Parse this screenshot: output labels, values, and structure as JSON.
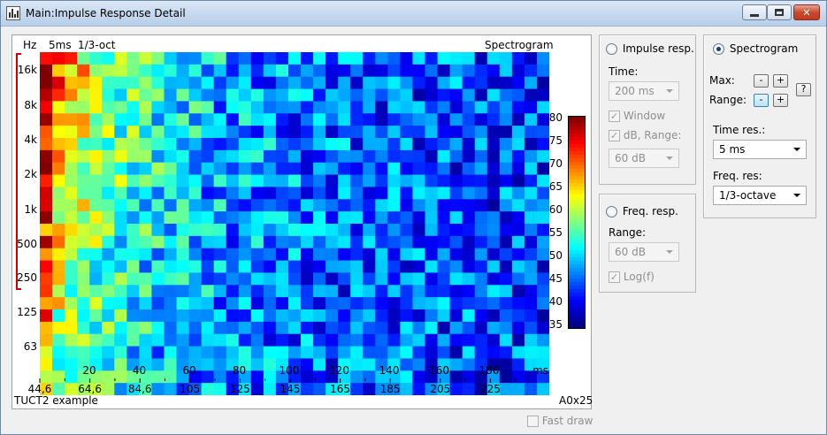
{
  "window": {
    "title": "Main:Impulse Response Detail"
  },
  "plot": {
    "unit_label": "Hz",
    "time_res_label": "5ms",
    "freq_res_label": "1/3-oct",
    "mode_label": "Spectrogram",
    "x_unit": "ms",
    "footer_left": "TUCT2 example",
    "footer_right": "A0x25",
    "y_ticks": [
      "16k",
      "8k",
      "4k",
      "2k",
      "1k",
      "500",
      "250",
      "125",
      "63"
    ],
    "x_ticks": [
      "20",
      "40",
      "60",
      "80",
      "100",
      "120",
      "140",
      "160",
      "180"
    ],
    "x_ticks2": [
      "44,6",
      "64,6",
      "84,6",
      "105",
      "125",
      "145",
      "165",
      "185",
      "205",
      "225"
    ],
    "colorbar_ticks": [
      "80",
      "75",
      "70",
      "65",
      "60",
      "55",
      "50",
      "45",
      "40",
      "35"
    ]
  },
  "chart_data": {
    "type": "heatmap",
    "title": "Spectrogram",
    "xlabel": "ms",
    "ylabel": "Hz",
    "xlim": [
      0,
      200
    ],
    "y_categories": [
      "16k",
      "8k",
      "4k",
      "2k",
      "1k",
      "500",
      "250",
      "125",
      "63"
    ],
    "colorbar_range": [
      35,
      80
    ],
    "colorscale": "jet"
  },
  "impulse_group": {
    "radio_label": "Impulse resp.",
    "time_label": "Time:",
    "time_value": "200 ms",
    "window_label": "Window",
    "db_range_label": "dB, Range:",
    "db_range_value": "60 dB"
  },
  "freq_group": {
    "radio_label": "Freq. resp.",
    "range_label": "Range:",
    "range_value": "60 dB",
    "log_label": "Log(f)"
  },
  "spectro_group": {
    "radio_label": "Spectrogram",
    "max_label": "Max:",
    "range_label": "Range:",
    "minus": "-",
    "plus": "+",
    "help": "?",
    "time_res_label": "Time res.:",
    "time_res_value": "5 ms",
    "freq_res_label": "Freq. res:",
    "freq_res_value": "1/3-octave"
  },
  "fast_draw_label": "Fast draw",
  "colors": {
    "title_bar": "#c5d8ee",
    "close_button": "#c74a2e",
    "bracket": "#d00000"
  }
}
